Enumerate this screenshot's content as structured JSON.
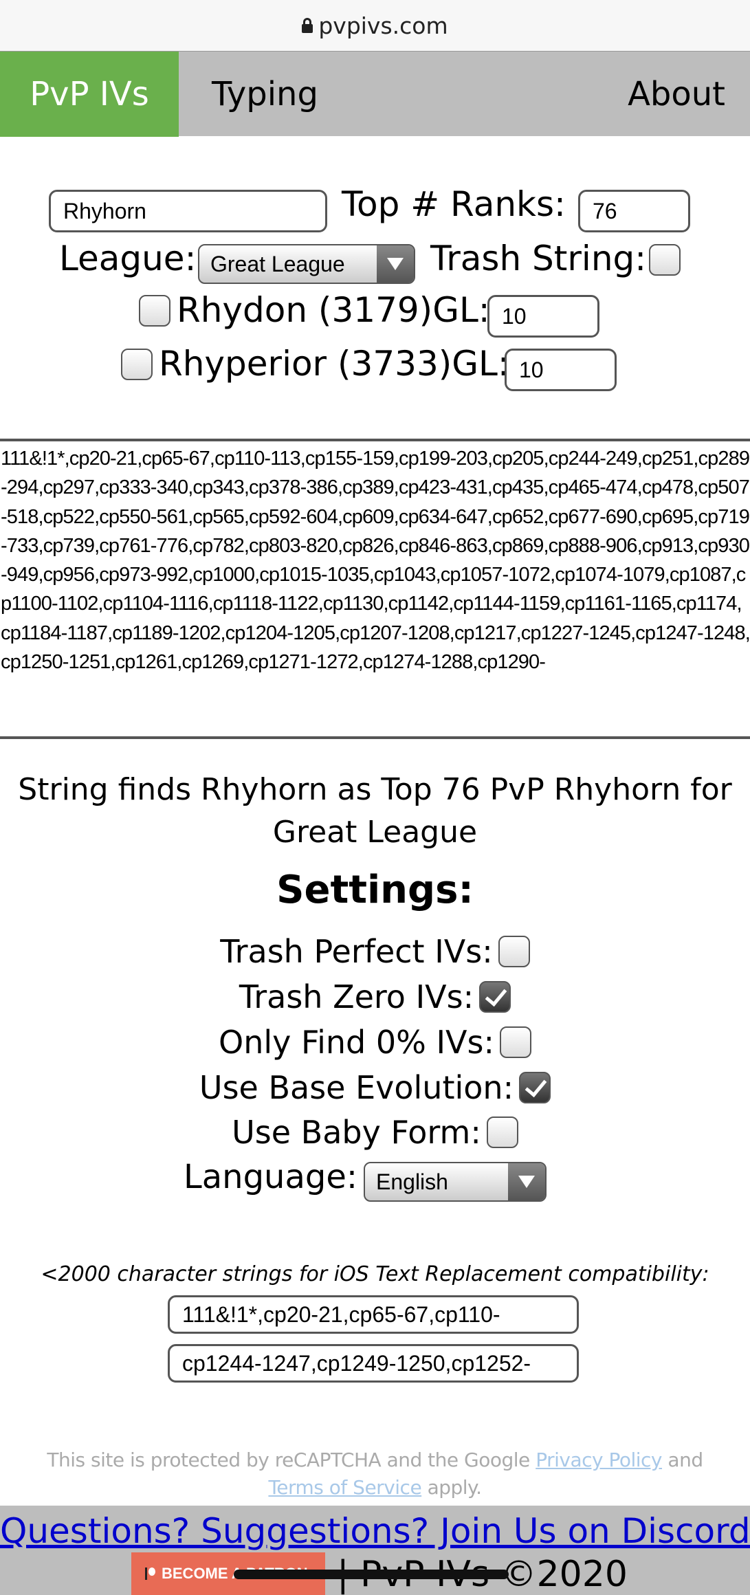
{
  "browser": {
    "url": "pvpivs.com",
    "lock_icon": "lock-icon"
  },
  "nav": {
    "tabs": [
      {
        "label": "PvP IVs",
        "active": true
      },
      {
        "label": "Typing"
      },
      {
        "label": "About"
      }
    ],
    "active_color": "#6ab04c"
  },
  "form": {
    "pokemon": "Rhyhorn",
    "top_ranks_label": "Top # Ranks:",
    "top_ranks": "76",
    "league_label": "League:",
    "league": "Great League",
    "trash_string_label": "Trash String:",
    "evolutions": [
      {
        "label": "Rhydon (3179)GL:",
        "value": "10",
        "checked": false
      },
      {
        "label": "Rhyperior (3733)GL:",
        "value": "10",
        "checked": false
      }
    ]
  },
  "output": "111&!1*,cp20-21,cp65-67,cp110-113,cp155-159,cp199-203,cp205,cp244-249,cp251,cp289-294,cp297,cp333-340,cp343,cp378-386,cp389,cp423-431,cp435,cp465-474,cp478,cp507-518,cp522,cp550-561,cp565,cp592-604,cp609,cp634-647,cp652,cp677-690,cp695,cp719-733,cp739,cp761-776,cp782,cp803-820,cp826,cp846-863,cp869,cp888-906,cp913,cp930-949,cp956,cp973-992,cp1000,cp1015-1035,cp1043,cp1057-1072,cp1074-1079,cp1087,cp1100-1102,cp1104-1116,cp1118-1122,cp1130,cp1142,cp1144-1159,cp1161-1165,cp1174,cp1184-1187,cp1189-1202,cp1204-1205,cp1207-1208,cp1217,cp1227-1245,cp1247-1248,cp1250-1251,cp1261,cp1269,cp1271-1272,cp1274-1288,cp1290-",
  "summary": "String finds Rhyhorn as Top 76 PvP Rhyhorn for Great League",
  "settings": {
    "title": "Settings:",
    "options": [
      {
        "label": "Trash Perfect IVs:",
        "checked": false
      },
      {
        "label": "Trash Zero IVs:",
        "checked": true
      },
      {
        "label": "Only Find 0% IVs:",
        "checked": false
      },
      {
        "label": "Use Base Evolution:",
        "checked": true
      },
      {
        "label": "Use Baby Form:",
        "checked": false
      }
    ],
    "language_label": "Language:",
    "language": "English"
  },
  "ios": {
    "note": "<2000 character strings for iOS Text Replacement compatibility:",
    "strings": [
      "111&!1*,cp20-21,cp65-67,cp110-",
      "cp1244-1247,cp1249-1250,cp1252-"
    ]
  },
  "recaptcha": {
    "pre": "This site is protected by reCAPTCHA and the Google ",
    "privacy": "Privacy Policy",
    "mid": " and ",
    "terms": "Terms of Service",
    "post": " apply."
  },
  "footer": {
    "discord": "Questions? Suggestions? Join Us on Discord!",
    "patreon": "BECOME A PATRON",
    "copyright": "| PvP IVs ©2020",
    "patreon_color": "#e86b55"
  }
}
